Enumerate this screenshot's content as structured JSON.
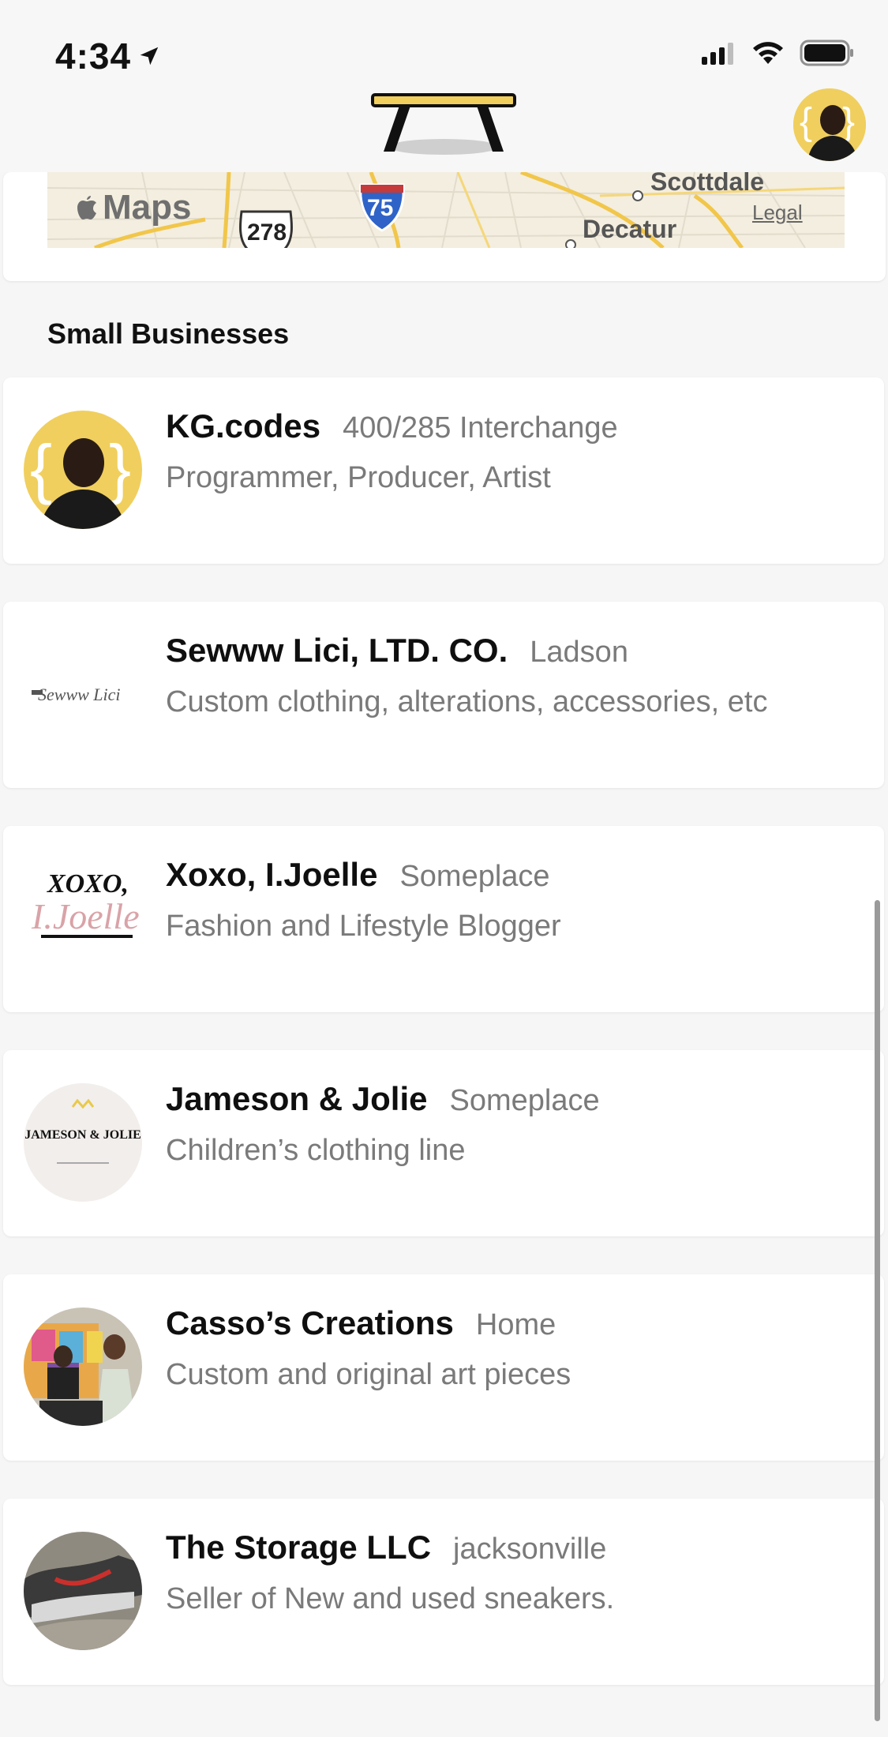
{
  "status_bar": {
    "time": "4:34",
    "icons": [
      "location-arrow-icon",
      "cellular-signal-icon",
      "wifi-icon",
      "battery-icon"
    ]
  },
  "header": {
    "logo": "table-logo",
    "profile_avatar": "profile-avatar"
  },
  "map": {
    "wordmark": "Maps",
    "places": [
      "Scottdale",
      "Decatur"
    ],
    "routes": [
      "278",
      "75"
    ],
    "legal": "Legal"
  },
  "section": {
    "title": "Small Businesses"
  },
  "businesses": [
    {
      "name": "KG.codes",
      "location": "400/285 Interchange",
      "description": "Programmer, Producer, Artist"
    },
    {
      "name": "Sewww Lici, LTD. CO.",
      "location": "Ladson",
      "description": "Custom clothing, alterations, accessories, etc"
    },
    {
      "name": "Xoxo, I.Joelle",
      "location": "Someplace",
      "description": "Fashion and Lifestyle Blogger"
    },
    {
      "name": "Jameson & Jolie",
      "location": "Someplace",
      "description": "Children’s clothing line"
    },
    {
      "name": "Casso’s Creations",
      "location": "Home",
      "description": "Custom and original art pieces"
    },
    {
      "name": "The Storage LLC",
      "location": "jacksonville",
      "description": "Seller of New and used sneakers."
    }
  ],
  "logos": {
    "sewww": "Sewww Lici",
    "xoxo_top": "XOXO,",
    "xoxo_script": "I.Joelle",
    "jameson": "JAMESON & JOLIE"
  },
  "colors": {
    "accent_yellow": "#f0cf5e",
    "background": "#f6f6f7",
    "card": "#ffffff",
    "secondary_text": "#7a7a7a"
  }
}
